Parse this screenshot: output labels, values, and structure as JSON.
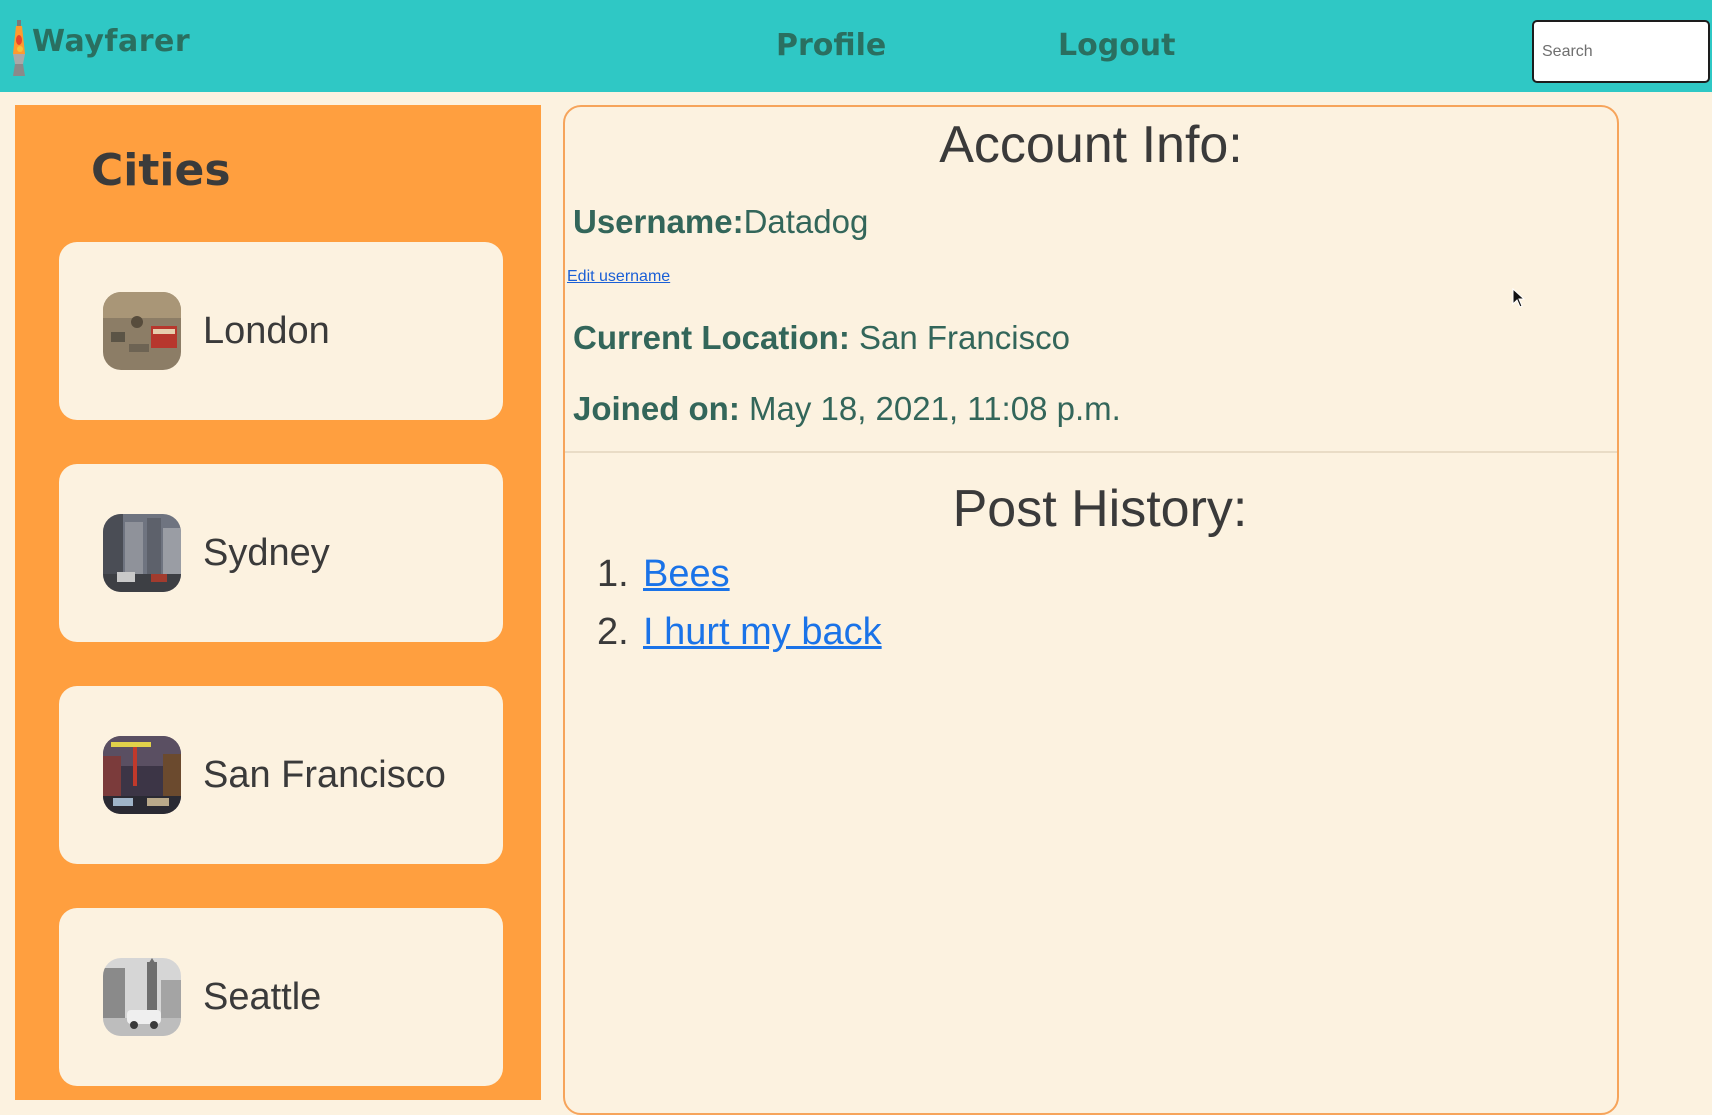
{
  "navbar": {
    "brand": "Wayfarer",
    "links": {
      "profile": "Profile",
      "logout": "Logout"
    },
    "search_placeholder": "Search",
    "colors": {
      "background": "#2fc8c5",
      "text": "#2a6f60"
    }
  },
  "sidebar": {
    "title": "Cities",
    "background": "#ff9f3f",
    "cities": [
      {
        "name": "London",
        "icon": "london-thumbnail"
      },
      {
        "name": "Sydney",
        "icon": "sydney-thumbnail"
      },
      {
        "name": "San Francisco",
        "icon": "san-francisco-thumbnail"
      },
      {
        "name": "Seattle",
        "icon": "seattle-thumbnail"
      }
    ]
  },
  "account": {
    "heading": "Account Info:",
    "username_label": "Username:",
    "username": "Datadog",
    "edit_username_link": "Edit username",
    "location_label": "Current Location:",
    "location": "San Francisco",
    "joined_label": "Joined on:",
    "joined": "May 18, 2021, 11:08 p.m."
  },
  "posts": {
    "heading": "Post History:",
    "items": [
      {
        "number": "1.",
        "title": "Bees"
      },
      {
        "number": "2.",
        "title": "I hurt my back"
      }
    ]
  }
}
